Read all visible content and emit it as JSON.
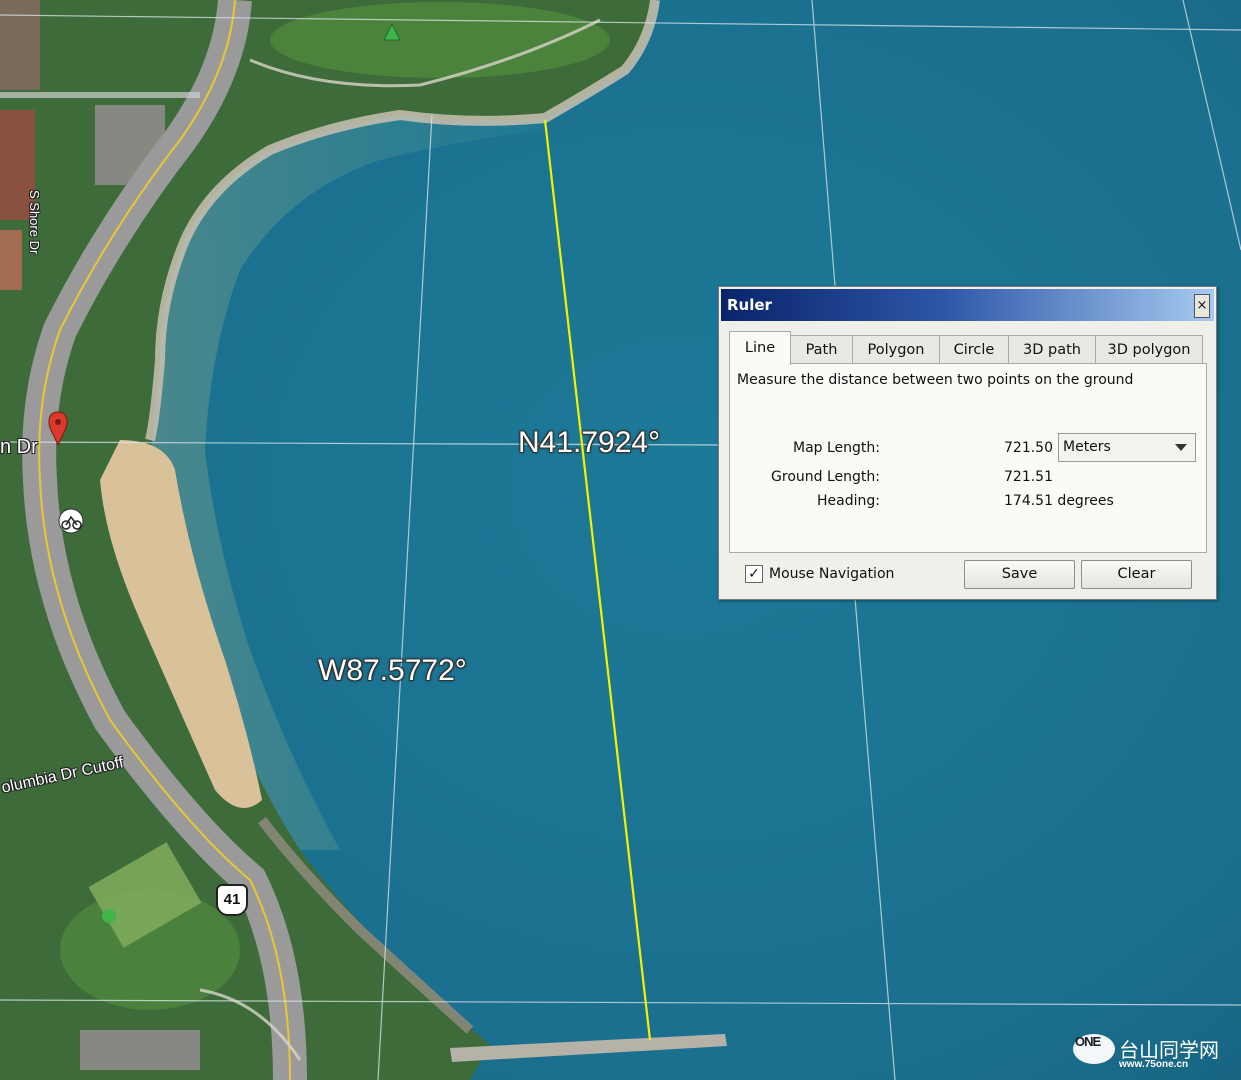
{
  "map": {
    "latitude_label": "N41.7924°",
    "longitude_label": "W87.5772°",
    "road_labels": [
      "n Dr",
      "S Shore Dr",
      "olumbia Dr Cutoff"
    ],
    "highway_shield": "41",
    "pin_icon": "map-pin-icon",
    "bike_icon": "bicycle-icon",
    "measure_line_color": "#f2f200",
    "water_color": "#1f7d97"
  },
  "ruler": {
    "title": "Ruler",
    "close_label": "×",
    "tabs": [
      {
        "label": "Line",
        "active": true
      },
      {
        "label": "Path"
      },
      {
        "label": "Polygon"
      },
      {
        "label": "Circle"
      },
      {
        "label": "3D path"
      },
      {
        "label": "3D polygon"
      }
    ],
    "description": "Measure the distance between two points on the ground",
    "map_length_label": "Map Length:",
    "map_length_value": "721.50",
    "unit_selected": "Meters",
    "ground_length_label": "Ground Length:",
    "ground_length_value": "721.51",
    "heading_label": "Heading:",
    "heading_value": "174.51 degrees",
    "mouse_navigation_label": "Mouse Navigation",
    "mouse_navigation_checked": "✓",
    "save_label": "Save",
    "clear_label": "Clear"
  },
  "watermark": {
    "logo_text": "ONE",
    "name": "台山同学网",
    "url": "www.75one.cn"
  }
}
